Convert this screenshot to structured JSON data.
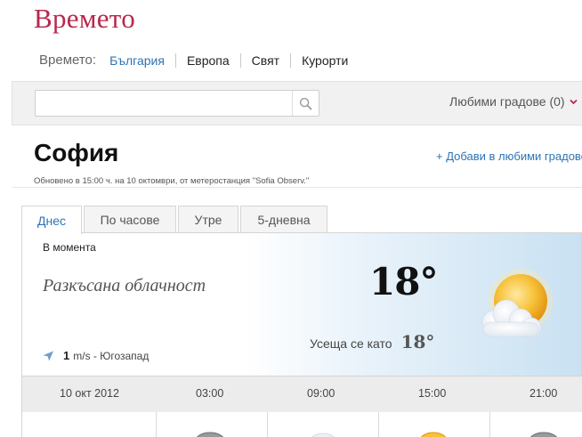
{
  "logo": {
    "text": "Времето"
  },
  "nav": {
    "lead": "Времето:",
    "items": [
      {
        "label": "България",
        "active": true
      },
      {
        "label": "Европа"
      },
      {
        "label": "Свят"
      },
      {
        "label": "Курорти"
      }
    ]
  },
  "search": {
    "value": "",
    "placeholder": "",
    "icon": "search-icon"
  },
  "favorites": {
    "label": "Любими градове (0)",
    "icon": "chevron-down-icon",
    "color": "#b8284c"
  },
  "location": {
    "city": "София",
    "updated": "Обновено в 15:00 ч. на 10 октомври, от метеростанция \"Sofia Observ.\"",
    "add_favorite": "+ Добави в любими градове"
  },
  "tabs": [
    {
      "label": "Днес",
      "active": true
    },
    {
      "label": "По часове"
    },
    {
      "label": "Утре"
    },
    {
      "label": "5-дневна"
    }
  ],
  "current": {
    "label": "В момента",
    "condition": "Разкъсана облачност",
    "temperature": "18°",
    "feels_like_label": "Усеща се като",
    "feels_like_value": "18°",
    "wind_speed": "1",
    "wind_text": "m/s - Югозапад",
    "icon": "partly-cloudy-icon"
  },
  "forecast": {
    "date": "10 окт 2012",
    "times": [
      "03:00",
      "09:00",
      "15:00",
      "21:00"
    ]
  },
  "colors": {
    "brand": "#b8284c",
    "link": "#2d74b5"
  }
}
